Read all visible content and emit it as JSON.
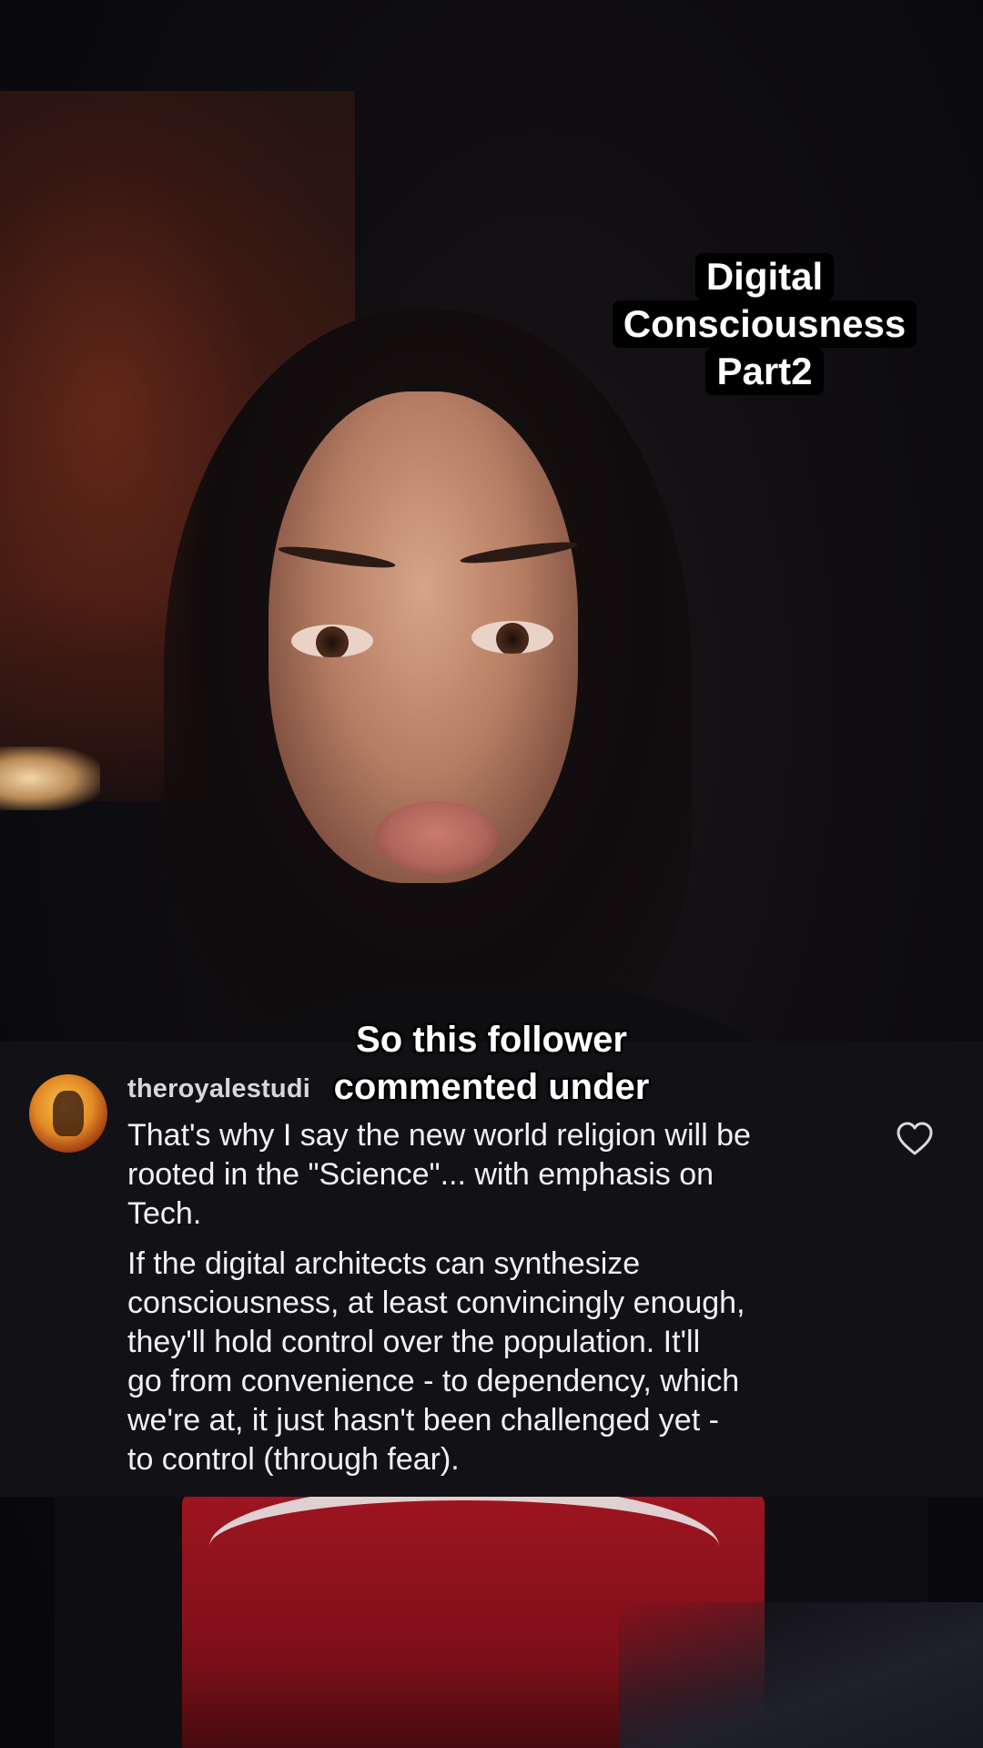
{
  "overlay_title": {
    "lines": [
      "Digital",
      "Consciousness",
      "Part2"
    ]
  },
  "caption": {
    "lines": [
      "So this follower",
      "commented under"
    ]
  },
  "comment": {
    "username": "theroyalestudi",
    "paragraphs": [
      "That's why I say the new world religion will be\nrooted in the \"Science\"... with emphasis on\nTech.",
      "If the digital architects can synthesize\nconsciousness, at least convincingly enough,\nthey'll hold control over the population. It'll\ngo from convenience - to dependency, which\nwe're at, it just hasn't been challenged yet -\nto control (through fear)."
    ],
    "like_icon": "heart-outline-icon"
  },
  "colors": {
    "title_bg": "#000000",
    "title_text": "#ffffff",
    "card_bg": "#121216",
    "comment_text": "#f2f2f4",
    "shirt_print": "#9e1520"
  }
}
